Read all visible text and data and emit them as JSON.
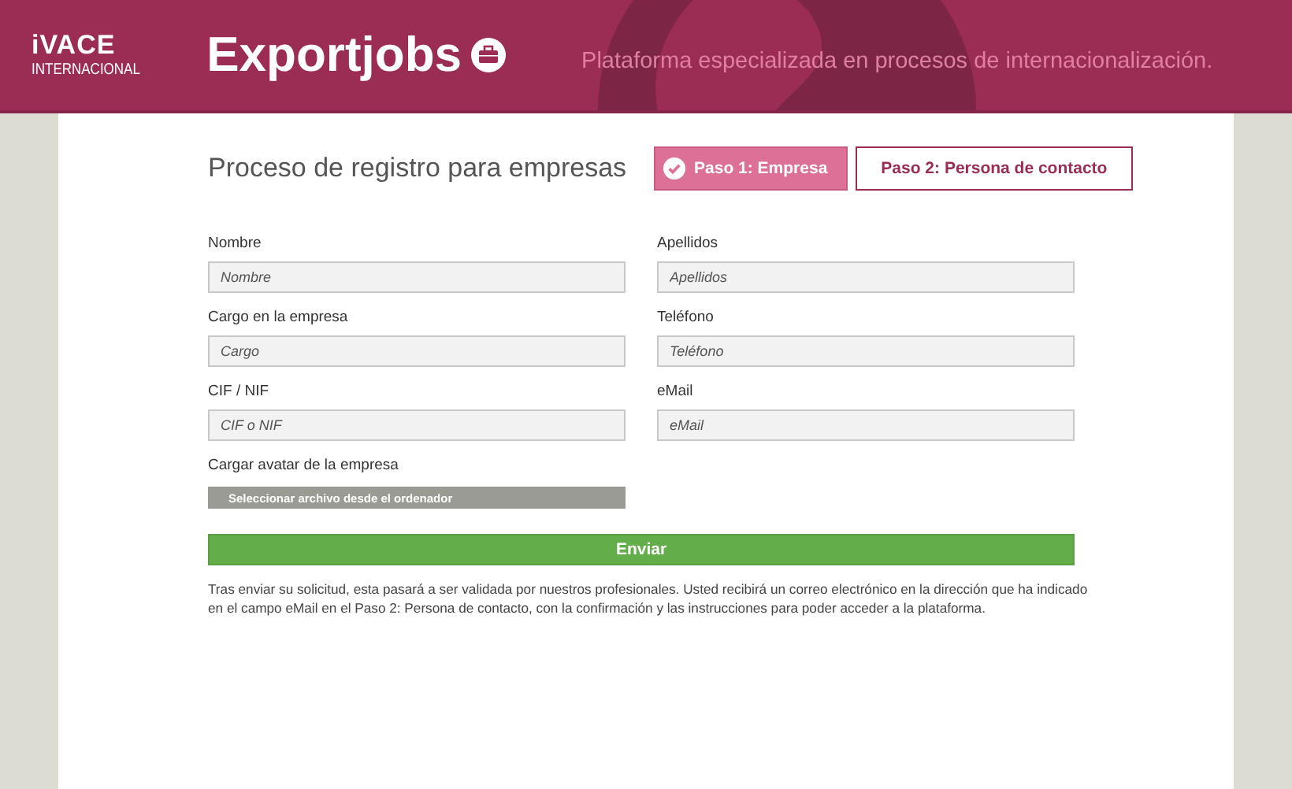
{
  "header": {
    "logo_top": "iVACE",
    "logo_bottom": "INTERNACIONAL",
    "title": "Exportjobs",
    "tagline": "Plataforma especializada en procesos de internacionalización."
  },
  "heading": "Proceso de registro para empresas",
  "steps": [
    {
      "label": "Paso 1: Empresa",
      "selected": true
    },
    {
      "label": "Paso 2: Persona de contacto",
      "selected": false
    }
  ],
  "fields": [
    {
      "label": "Nombre",
      "placeholder": "Nombre"
    },
    {
      "label": "Apellidos",
      "placeholder": "Apellidos"
    },
    {
      "label": "Cargo en la empresa",
      "placeholder": "Cargo"
    },
    {
      "label": "Teléfono",
      "placeholder": "Teléfono"
    },
    {
      "label": "CIF / NIF",
      "placeholder": "CIF o NIF"
    },
    {
      "label": "eMail",
      "placeholder": "eMail"
    }
  ],
  "avatar": {
    "label": "Cargar avatar de la empresa",
    "button": "Seleccionar archivo desde el ordenador"
  },
  "submit": "Enviar",
  "note": "Tras enviar su solicitud, esta pasará a ser validada por nuestros profesionales. Usted recibirá un correo electrónico en la dirección que ha indicado en el campo eMail en el Paso 2: Persona de contacto, con la confirmación y las instrucciones para poder acceder a la plataforma."
}
